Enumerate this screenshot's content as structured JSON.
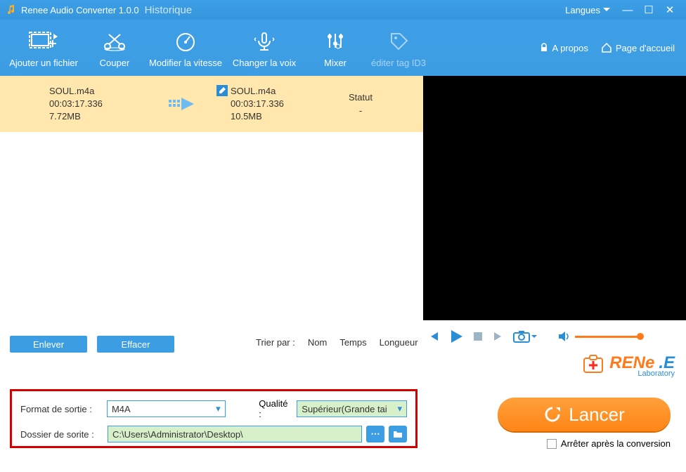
{
  "titlebar": {
    "app_title": "Renee Audio Converter 1.0.0",
    "history_link": "Historique",
    "language_label": "Langues"
  },
  "toolbar": {
    "add_file": "Ajouter un fichier",
    "cut": "Couper",
    "speed": "Modifier la vitesse",
    "voice": "Changer la voix",
    "mixer": "Mixer",
    "id3": "éditer tag ID3",
    "about": "A propos",
    "home": "Page d'accueil"
  },
  "file": {
    "src_name": "SOUL.m4a",
    "src_duration": "00:03:17.336",
    "src_size": "7.72MB",
    "dst_name": "SOUL.m4a",
    "dst_duration": "00:03:17.336",
    "dst_size": "10.5MB",
    "status_label": "Statut",
    "status_value": "-"
  },
  "actions": {
    "remove": "Enlever",
    "clear": "Effacer"
  },
  "sort": {
    "label": "Trier par :",
    "name": "Nom",
    "time": "Temps",
    "length": "Longueur"
  },
  "brand": {
    "part1": "RENe",
    "part2": ".E",
    "lab": "Laboratory"
  },
  "settings": {
    "format_label": "Format de sortie :",
    "format_value": "M4A",
    "quality_label": "Qualité :",
    "quality_value": "Supérieur(Grande tai",
    "folder_label": "Dossier de sorite :",
    "folder_value": "C:\\Users\\Administrator\\Desktop\\"
  },
  "launch": {
    "label": "Lancer"
  },
  "after": {
    "label": "Arrêter après la conversion"
  }
}
